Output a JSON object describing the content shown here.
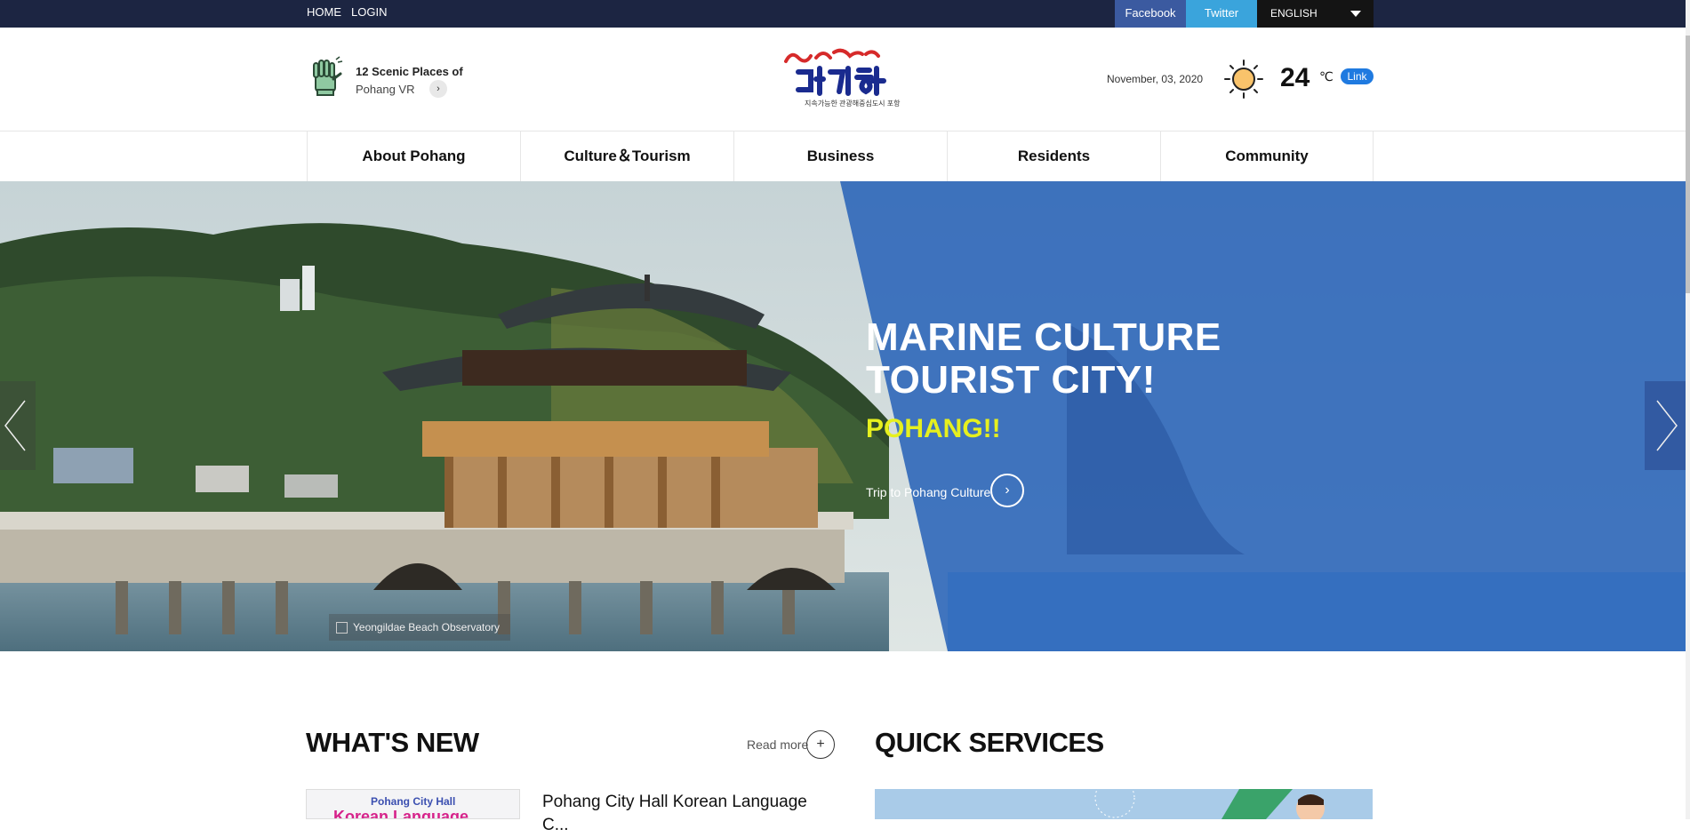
{
  "topbar": {
    "home": "HOME",
    "login": "LOGIN",
    "facebook": "Facebook",
    "twitter": "Twitter",
    "language": "ENGLISH"
  },
  "header": {
    "vr_line1": "12 Scenic Places of",
    "vr_line2": "Pohang VR",
    "logo_slogan": "지속가능한 관광해중심도시 포항",
    "logo_alt": "삶과 도시의 대전환",
    "date": "November, 03, 2020",
    "temperature": "24",
    "temp_unit": "℃",
    "weather_link": "Link",
    "weather_icon": "sun-icon"
  },
  "nav": {
    "items": [
      {
        "label": "About Pohang"
      },
      {
        "label": "Culture＆Tourism"
      },
      {
        "label": "Business"
      },
      {
        "label": "Residents"
      },
      {
        "label": "Community"
      }
    ]
  },
  "hero": {
    "headline_line1": "MARINE CULTURE",
    "headline_line2": "TOURIST CITY!",
    "subheadline": "POHANG!!",
    "cta": "Trip to Pohang Culture",
    "photo_caption": "Yeongildae Beach Observatory",
    "accent": "#2a64b8",
    "subheadline_color": "#e6f01e"
  },
  "whats_new": {
    "title": "WHAT'S NEW",
    "read_more": "Read more",
    "item_title": "Pohang City Hall Korean Language C...",
    "thumb_line1": "Pohang City Hall",
    "thumb_line2": "Korean Language"
  },
  "quick_services": {
    "title": "QUICK SERVICES"
  }
}
